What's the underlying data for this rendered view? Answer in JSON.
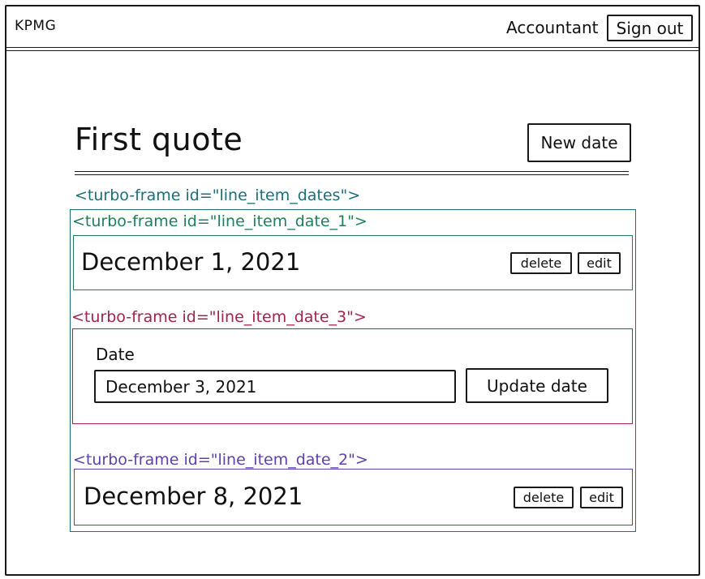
{
  "navbar": {
    "brand": "KPMG",
    "role": "Accountant",
    "sign_out_label": "Sign out"
  },
  "main": {
    "title": "First quote",
    "new_date_label": "New date"
  },
  "frames": {
    "outer_label": "<turbo-frame id=\"line_item_dates\">",
    "item1": {
      "label": "<turbo-frame id=\"line_item_date_1\">",
      "date": "December 1, 2021",
      "delete_label": "delete",
      "edit_label": "edit"
    },
    "item3": {
      "label": "<turbo-frame id=\"line_item_date_3\">",
      "field_label": "Date",
      "field_value": "December 3, 2021",
      "submit_label": "Update date"
    },
    "item2": {
      "label": "<turbo-frame id=\"line_item_date_2\">",
      "date": "December 8, 2021",
      "delete_label": "delete",
      "edit_label": "edit"
    }
  },
  "colors": {
    "outer_frame": "#1a6f78",
    "frame_1": "#1f7f5c",
    "frame_3": "#a3234a",
    "frame_2": "#5e3fb0"
  }
}
